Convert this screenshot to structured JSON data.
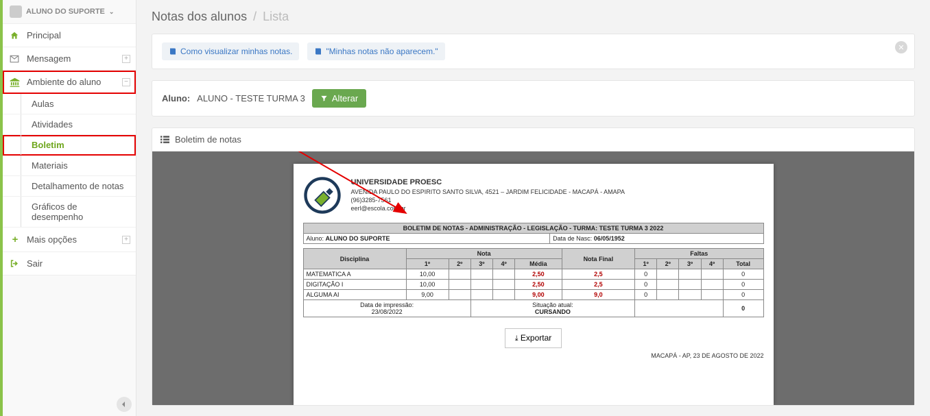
{
  "user": {
    "name": "ALUNO DO SUPORTE"
  },
  "sidebar": {
    "principal": "Principal",
    "mensagem": "Mensagem",
    "ambiente": "Ambiente do aluno",
    "sub": {
      "aulas": "Aulas",
      "atividades": "Atividades",
      "boletim": "Boletim",
      "materiais": "Materiais",
      "detalhamento": "Detalhamento de notas",
      "graficos": "Gráficos de desempenho"
    },
    "mais": "Mais opções",
    "sair": "Sair"
  },
  "breadcrumb": {
    "title": "Notas dos alunos",
    "current": "Lista"
  },
  "alerts": {
    "link1": "Como visualizar minhas notas.",
    "link2": "\"Minhas notas não aparecem.\""
  },
  "student": {
    "label": "Aluno:",
    "name": "ALUNO - TESTE TURMA 3",
    "alterar": "Alterar"
  },
  "card": {
    "title": "Boletim de notas"
  },
  "report": {
    "school": "UNIVERSIDADE PROESC",
    "addr": "AVENIDA PAULO DO ESPIRITO SANTO SILVA, 4521 – JARDIM FELICIDADE - MACAPÁ - AMAPA",
    "phone": "(96)3285-7561",
    "email": "eerl@escola.com.br",
    "tableTitle": "BOLETIM DE NOTAS - ADMINISTRAÇÃO - LEGISLAÇÃO - TURMA: TESTE TURMA 3 2022",
    "alunoLabel": "Aluno:",
    "alunoName": "ALUNO DO SUPORTE",
    "nascLabel": "Data de Nasc:",
    "nascVal": "06/05/1952",
    "cols": {
      "disciplina": "Disciplina",
      "nota": "Nota",
      "notafinal": "Nota Final",
      "faltas": "Faltas",
      "p1": "1º",
      "p2": "2º",
      "p3": "3º",
      "p4": "4º",
      "media": "Média",
      "total": "Total"
    },
    "rows": [
      {
        "disc": "MATEMATICA A",
        "p1": "10,00",
        "p2": "",
        "p3": "",
        "p4": "",
        "media": "2,50",
        "final": "2,5",
        "f1": "0",
        "f2": "",
        "f3": "",
        "f4": "",
        "ft": "0"
      },
      {
        "disc": "DIGITAÇÃO I",
        "p1": "10,00",
        "p2": "",
        "p3": "",
        "p4": "",
        "media": "2,50",
        "final": "2,5",
        "f1": "0",
        "f2": "",
        "f3": "",
        "f4": "",
        "ft": "0"
      },
      {
        "disc": "ALGUMA AI",
        "p1": "9,00",
        "p2": "",
        "p3": "",
        "p4": "",
        "media": "9,00",
        "final": "9,0",
        "f1": "0",
        "f2": "",
        "f3": "",
        "f4": "",
        "ft": "0"
      }
    ],
    "printLabel": "Data de impressão:",
    "printVal": "23/08/2022",
    "sitLabel": "Situação atual:",
    "sitVal": "CURSANDO",
    "totalFaltas": "0",
    "export": "Exportar",
    "footer": "MACAPÁ - AP, 23 DE AGOSTO DE 2022"
  }
}
